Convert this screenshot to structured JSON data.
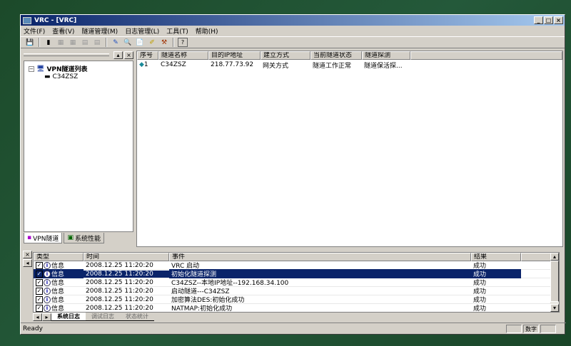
{
  "title": "VRC - [VRC]",
  "menu": [
    "文件(F)",
    "查看(V)",
    "隧道管理(M)",
    "日志管理(L)",
    "工具(T)",
    "帮助(H)"
  ],
  "left_panel": {
    "tree_root": "VPN隧道列表",
    "tree_child": "C34ZSZ",
    "tabs": [
      "VPN隧道",
      "系统性能"
    ]
  },
  "tunnel_table": {
    "columns": [
      "序号",
      "隧道名称",
      "目的IP地址",
      "建立方式",
      "当前隧道状态",
      "隧道探测"
    ],
    "rows": [
      [
        "1",
        "C34ZSZ",
        "218.77.73.92",
        "网关方式",
        "隧道工作正常",
        "隧道保活探..."
      ]
    ]
  },
  "log_table": {
    "columns": [
      "类型",
      "时间",
      "事件",
      "结果"
    ],
    "rows": [
      [
        "信息",
        "2008.12.25    11:20:20",
        "VRC 启动",
        "成功"
      ],
      [
        "信息",
        "2008.12.25    11:20:20",
        "初始化隧道探测",
        "成功"
      ],
      [
        "信息",
        "2008.12.25    11:20:20",
        "C34ZSZ--本地IP地址--192.168.34.100",
        "成功"
      ],
      [
        "信息",
        "2008.12.25    11:20:20",
        "启动隧道---C34ZSZ",
        "成功"
      ],
      [
        "信息",
        "2008.12.25    11:20:20",
        "加密算法DES:初始化成功",
        "成功"
      ],
      [
        "信息",
        "2008.12.25    11:20:20",
        "NATMAP:初始化成功",
        "成功"
      ]
    ],
    "selected_row": 1
  },
  "log_tabs": [
    "系统日志",
    "调试日志",
    "状态统计"
  ],
  "status": {
    "text": "Ready",
    "indicator": "数字"
  }
}
